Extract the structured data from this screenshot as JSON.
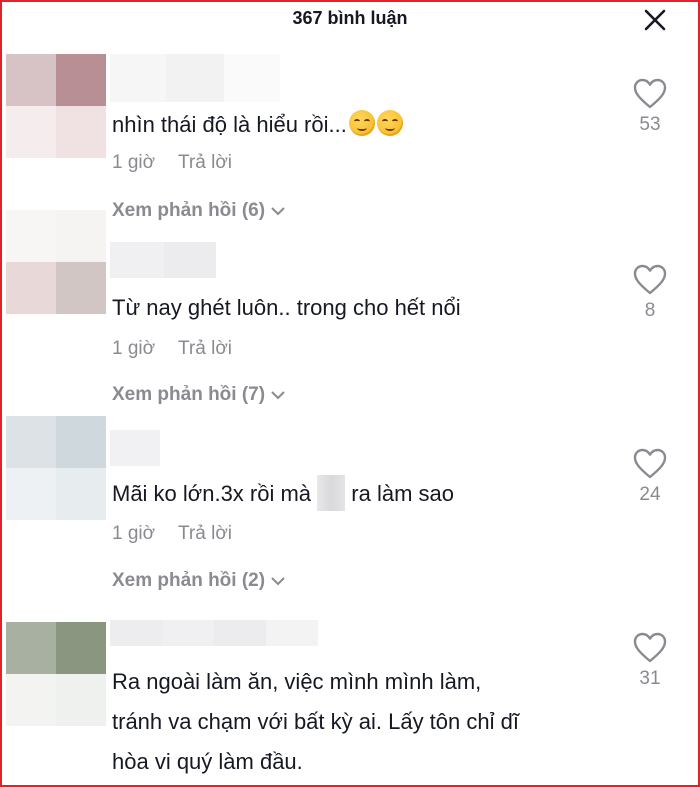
{
  "header": {
    "title": "367 bình luận"
  },
  "comments": [
    {
      "text": "nhìn thái độ là hiểu rồi...",
      "emoji": [
        "smirk-emoji",
        "smirk-emoji"
      ],
      "time": "1 giờ",
      "reply_label": "Trả lời",
      "view_replies": "Xem phản hồi (6)",
      "likes": "53",
      "avatar_colors": [
        "#d7c2c6",
        "#b88f95",
        "#f4eced",
        "#f0e1e3"
      ]
    },
    {
      "text": "Từ nay ghét luôn.. trong cho hết nổi",
      "time": "1 giờ",
      "reply_label": "Trả lời",
      "view_replies": "Xem phản hồi (7)",
      "likes": "8",
      "avatar_colors": [
        "#e8d8d7",
        "#d2c6c5",
        "#f6f1f1",
        "#f3eeee"
      ]
    },
    {
      "text_before": "Mãi ko lớn.3x rồi mà ",
      "text_after": " ra làm sao",
      "time": "1 giờ",
      "reply_label": "Trả lời",
      "view_replies": "Xem phản hồi (2)",
      "likes": "24",
      "avatar_colors": [
        "#dde2e6",
        "#cfd8dc",
        "#eef1f3",
        "#e7ecee"
      ]
    },
    {
      "lines": [
        "Ra ngoài làm ăn, việc mình mình làm,",
        "tránh va chạm với bất kỳ ai. Lấy tôn chỉ dĩ",
        "hòa vi quý làm đầu."
      ],
      "likes": "31",
      "avatar_colors": [
        "#a8b0a2",
        "#8a967f",
        "#f3f4f2",
        "#eff1ee"
      ]
    }
  ],
  "colors": {
    "border": "#e0222b",
    "muted": "#8a8b91",
    "text": "#161823"
  }
}
